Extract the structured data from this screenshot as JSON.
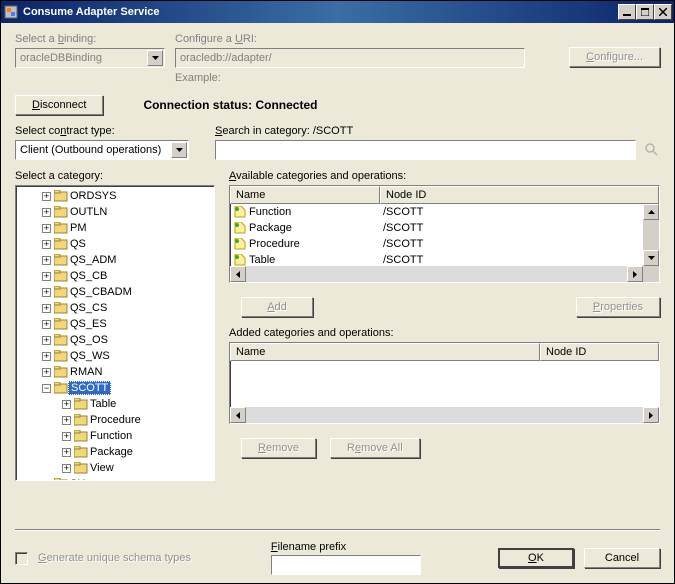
{
  "window": {
    "title": "Consume Adapter Service"
  },
  "binding": {
    "label": "Select a binding:",
    "value": "oracleDBBinding"
  },
  "uri": {
    "label": "Configure a URI:",
    "value": "oracledb://adapter/",
    "example_label": "Example:"
  },
  "configure_btn": "Configure...",
  "disconnect_btn": "Disconnect",
  "conn_status_label": "Connection status:",
  "conn_status_value": "Connected",
  "contract": {
    "label": "Select contract type:",
    "value": "Client (Outbound operations)"
  },
  "search": {
    "label": "Search in category: /SCOTT",
    "value": ""
  },
  "category_label": "Select a category:",
  "tree": {
    "items": [
      {
        "label": "ORDSYS",
        "toggle": "+",
        "indent": 1
      },
      {
        "label": "OUTLN",
        "toggle": "+",
        "indent": 1
      },
      {
        "label": "PM",
        "toggle": "+",
        "indent": 1
      },
      {
        "label": "QS",
        "toggle": "+",
        "indent": 1
      },
      {
        "label": "QS_ADM",
        "toggle": "+",
        "indent": 1
      },
      {
        "label": "QS_CB",
        "toggle": "+",
        "indent": 1
      },
      {
        "label": "QS_CBADM",
        "toggle": "+",
        "indent": 1
      },
      {
        "label": "QS_CS",
        "toggle": "+",
        "indent": 1
      },
      {
        "label": "QS_ES",
        "toggle": "+",
        "indent": 1
      },
      {
        "label": "QS_OS",
        "toggle": "+",
        "indent": 1
      },
      {
        "label": "QS_WS",
        "toggle": "+",
        "indent": 1
      },
      {
        "label": "RMAN",
        "toggle": "+",
        "indent": 1
      },
      {
        "label": "SCOTT",
        "toggle": "−",
        "indent": 1,
        "selected": true
      },
      {
        "label": "Table",
        "toggle": "+",
        "indent": 2
      },
      {
        "label": "Procedure",
        "toggle": "+",
        "indent": 2
      },
      {
        "label": "Function",
        "toggle": "+",
        "indent": 2
      },
      {
        "label": "Package",
        "toggle": "+",
        "indent": 2
      },
      {
        "label": "View",
        "toggle": "+",
        "indent": 2
      },
      {
        "label": "SH",
        "toggle": "+",
        "indent": 1
      }
    ]
  },
  "available": {
    "label": "Available categories and operations:",
    "cols": {
      "name": "Name",
      "node": "Node ID"
    },
    "rows": [
      {
        "name": "Function",
        "node": "/SCOTT"
      },
      {
        "name": "Package",
        "node": "/SCOTT"
      },
      {
        "name": "Procedure",
        "node": "/SCOTT"
      },
      {
        "name": "Table",
        "node": "/SCOTT"
      }
    ]
  },
  "add_btn": "Add",
  "properties_btn": "Properties",
  "added": {
    "label": "Added categories and operations:",
    "cols": {
      "name": "Name",
      "node": "Node ID"
    }
  },
  "remove_btn": "Remove",
  "removeall_btn": "Remove All",
  "gen_schema": "Generate unique schema types",
  "filename_prefix": "Filename prefix",
  "ok_btn": "OK",
  "cancel_btn": "Cancel"
}
